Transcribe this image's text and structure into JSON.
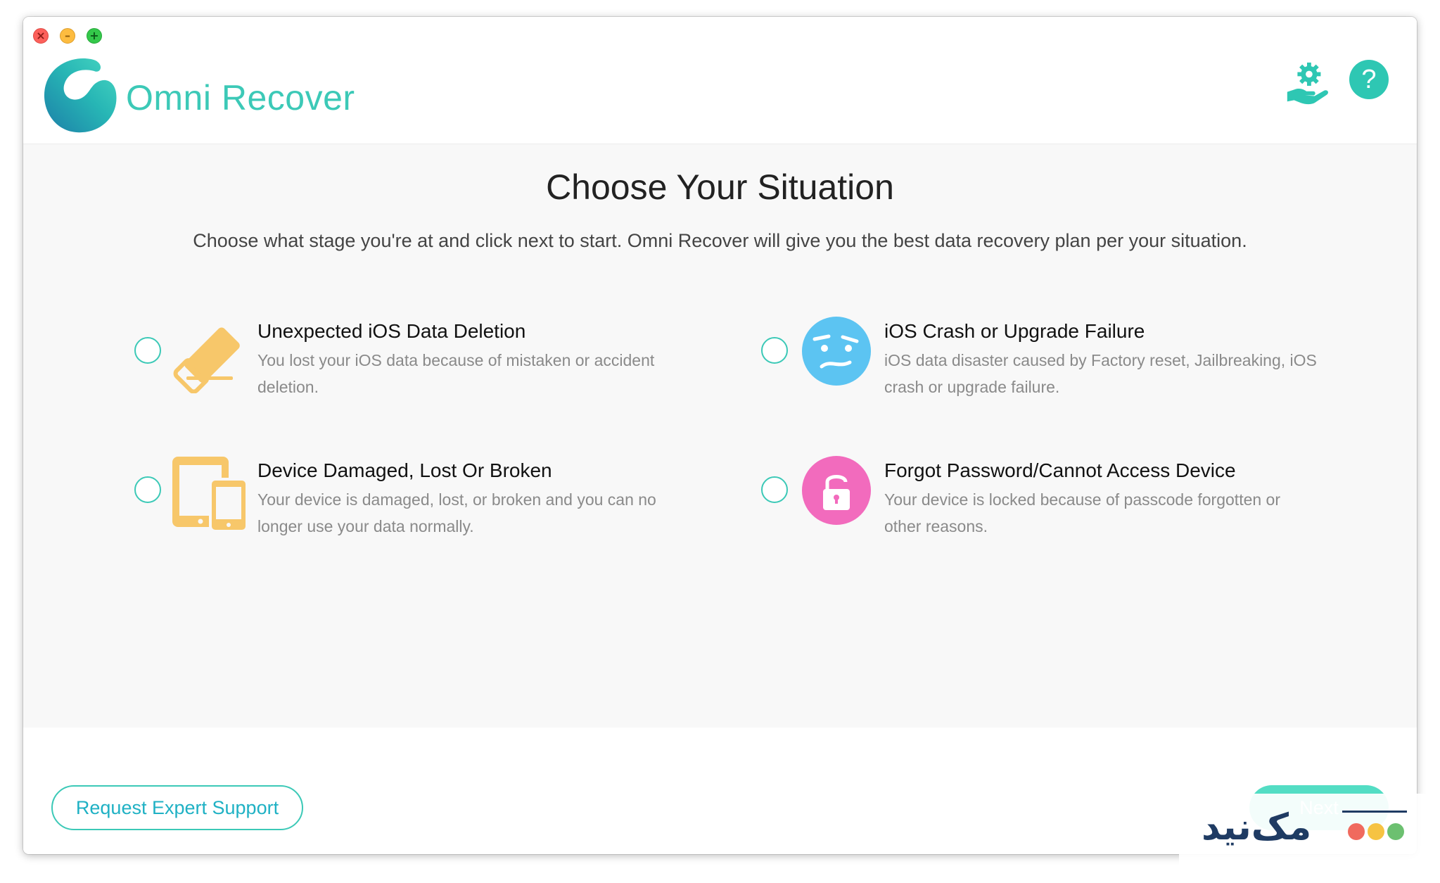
{
  "app": {
    "name": "Omni Recover",
    "brand_color": "#3cc9b7"
  },
  "window_controls": {
    "close_icon": "close-icon",
    "minimize_icon": "minimize-icon",
    "maximize_icon": "maximize-icon"
  },
  "header": {
    "support_icon": "gear-hand-icon",
    "help_label": "?"
  },
  "main": {
    "title": "Choose Your Situation",
    "subtitle": "Choose what stage you're at and click next to start. Omni Recover will give you the best data recovery plan per your situation.",
    "options": [
      {
        "title": "Unexpected iOS Data Deletion",
        "description": "You lost your iOS data because of mistaken or accident deletion.",
        "icon": "eraser-icon",
        "color": "#f7c76a"
      },
      {
        "title": "iOS Crash or Upgrade Failure",
        "description": "iOS data disaster caused by Factory reset, Jailbreaking, iOS crash or upgrade failure.",
        "icon": "confused-face-icon",
        "color": "#5cc4f2"
      },
      {
        "title": "Device Damaged, Lost Or Broken",
        "description": "Your device is damaged, lost, or broken and you can no longer use your data normally.",
        "icon": "devices-icon",
        "color": "#f7c76a"
      },
      {
        "title": "Forgot Password/Cannot Access Device",
        "description": "Your device is locked because of passcode forgotten or other reasons.",
        "icon": "lock-icon",
        "color": "#f26bbd"
      }
    ]
  },
  "footer": {
    "expert_label": "Request Expert Support",
    "next_label": "Next"
  },
  "watermark": {
    "text": "مک‌نید"
  }
}
